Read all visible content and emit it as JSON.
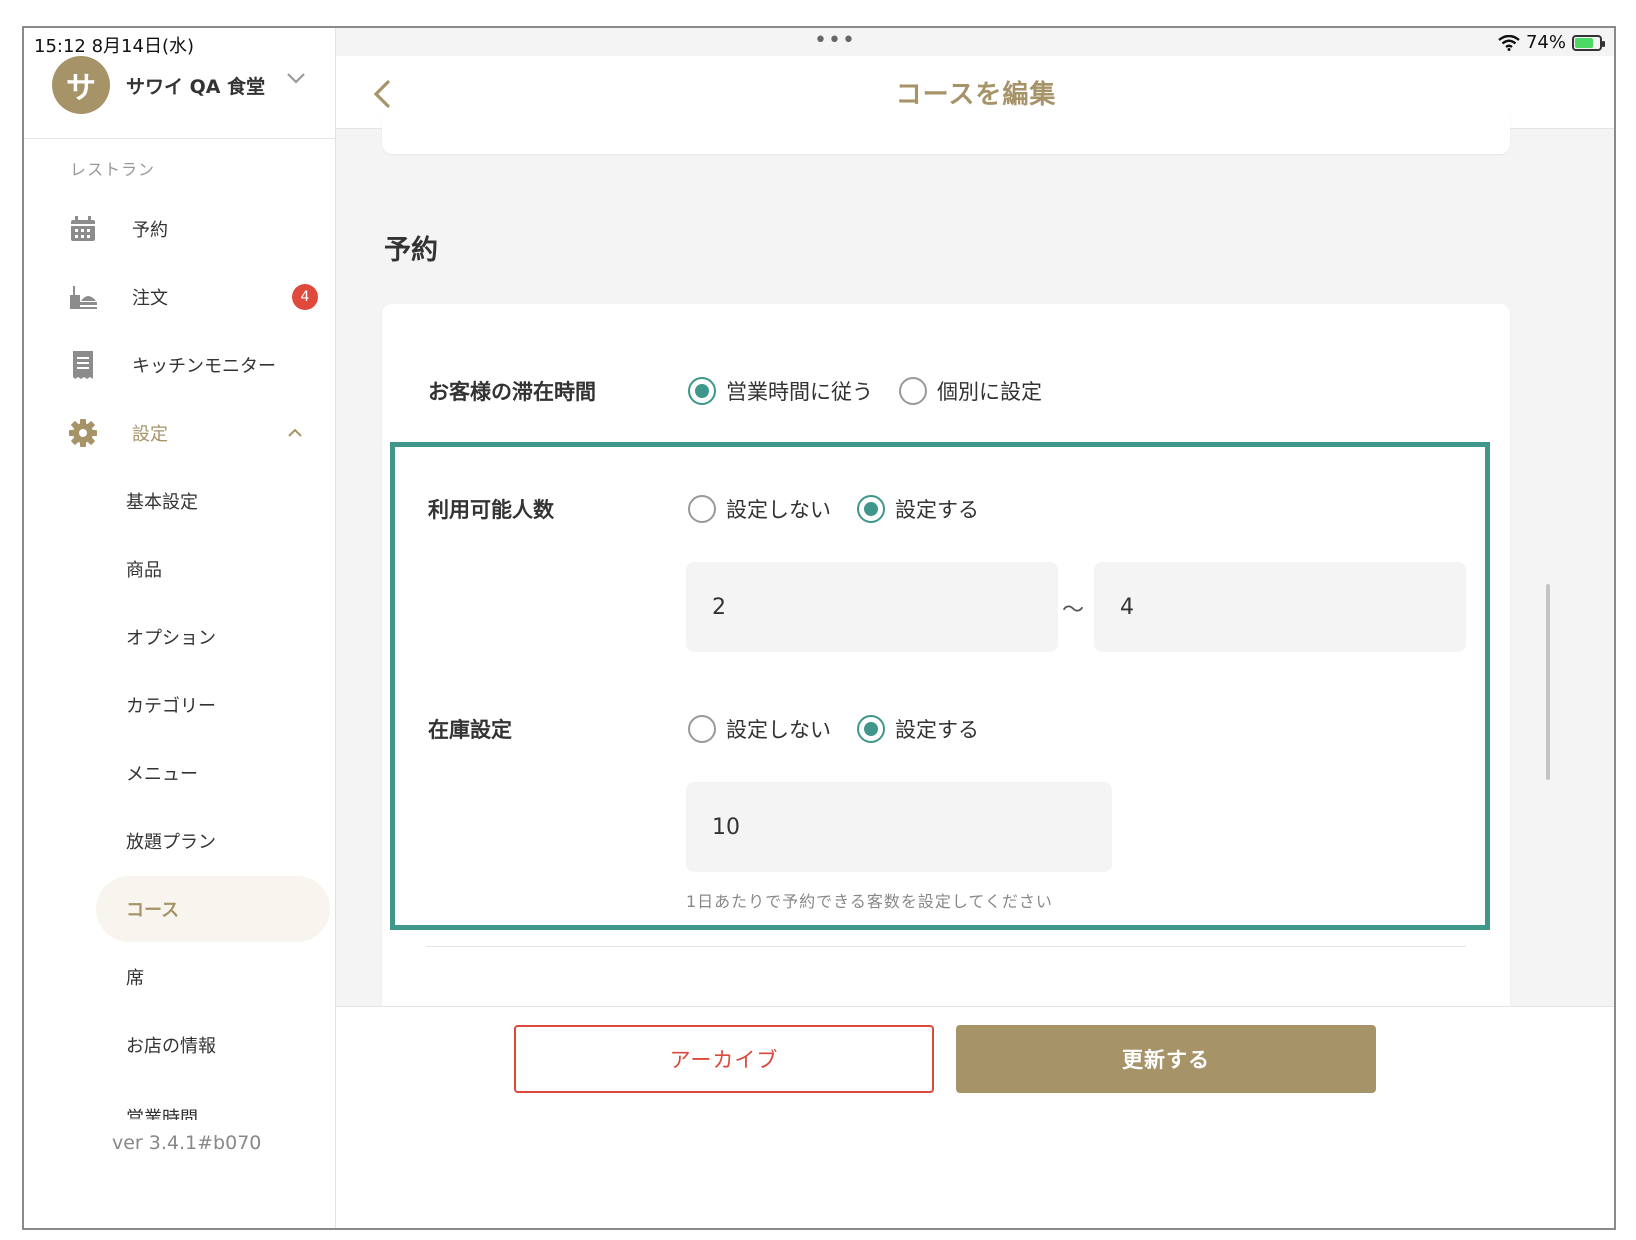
{
  "status_bar": {
    "time_date": "15:12   8月14日(水)",
    "dots": "•••",
    "battery": "74%"
  },
  "sidebar": {
    "store_initial": "サ",
    "store_name": "サワイ QA 食堂",
    "section_label": "レストラン",
    "items": [
      {
        "label": "予約"
      },
      {
        "label": "注文",
        "badge": "4"
      },
      {
        "label": "キッチンモニター"
      },
      {
        "label": "設定"
      }
    ],
    "sub_items": [
      {
        "label": "基本設定"
      },
      {
        "label": "商品"
      },
      {
        "label": "オプション"
      },
      {
        "label": "カテゴリー"
      },
      {
        "label": "メニュー"
      },
      {
        "label": "放題プラン"
      },
      {
        "label": "コース"
      },
      {
        "label": "席"
      },
      {
        "label": "お店の情報"
      },
      {
        "label": "営業時間"
      }
    ],
    "version": "ver 3.4.1#b070"
  },
  "header": {
    "title": "コースを編集"
  },
  "form": {
    "section_title": "予約",
    "stay_time": {
      "label": "お客様の滞在時間",
      "options": [
        "営業時間に従う",
        "個別に設定"
      ],
      "selected": 0
    },
    "available_people": {
      "label": "利用可能人数",
      "options": [
        "設定しない",
        "設定する"
      ],
      "selected": 1,
      "min": "2",
      "tilde": "〜",
      "max": "4"
    },
    "stock": {
      "label": "在庫設定",
      "options": [
        "設定しない",
        "設定する"
      ],
      "selected": 1,
      "value": "10",
      "hint": "1日あたりで予約できる客数を設定してください"
    }
  },
  "actions": {
    "archive_label": "アーカイブ",
    "update_label": "更新する"
  },
  "colors": {
    "brand": "#a69368",
    "accent": "#3f968b",
    "danger": "#d94a3c",
    "badge": "#e04a3c"
  }
}
